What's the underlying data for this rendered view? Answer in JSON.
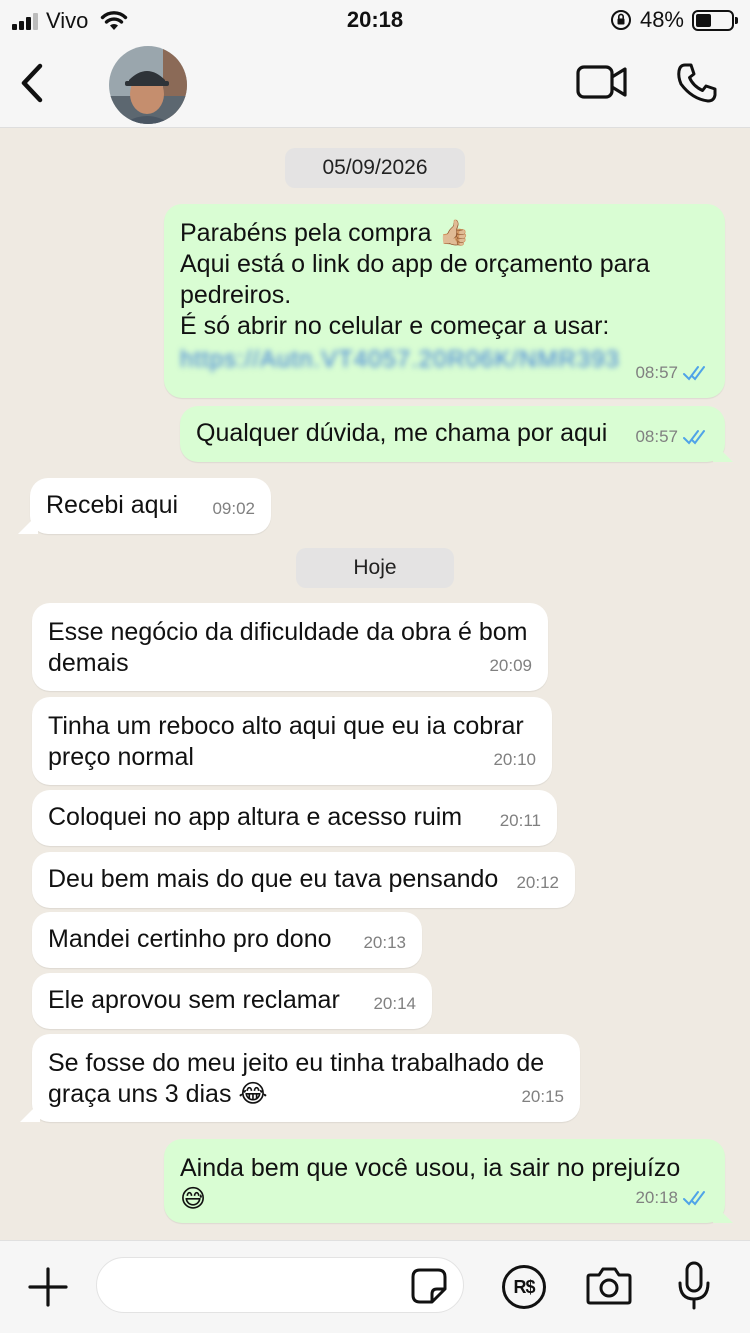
{
  "status_bar": {
    "carrier": "Vivo",
    "time": "20:18",
    "battery": "48%",
    "battery_level": 0.48
  },
  "header": {
    "back_icon": "chevron-left-icon",
    "avatar": "contact-avatar",
    "video_icon": "video-camera-icon",
    "call_icon": "phone-icon"
  },
  "chat": {
    "date_1": "05/09/2026",
    "date_2": "Hoje",
    "messages": [
      {
        "dir": "out",
        "lines": [
          "Parabéns pela compra 👍🏼",
          "Aqui está o link do app de orçamento para",
          "pedreiros.",
          "É só abrir no celular e começar a usar:"
        ],
        "link": "https://Autn.VT4057.20R06K/NMR393",
        "time": "08:57"
      },
      {
        "dir": "out",
        "text": "Qualquer dúvida, me chama por aqui",
        "time": "08:57"
      },
      {
        "dir": "in",
        "text": "Recebi aqui",
        "time": "09:02"
      },
      {
        "dir": "in",
        "lines": [
          "Esse negócio da dificuldade da obra é bom",
          "demais"
        ],
        "time": "20:09"
      },
      {
        "dir": "in",
        "lines": [
          "Tinha um reboco alto aqui que eu ia cobrar",
          "preço normal"
        ],
        "time": "20:10"
      },
      {
        "dir": "in",
        "text": "Coloquei no app altura e acesso ruim",
        "time": "20:11"
      },
      {
        "dir": "in",
        "text": "Deu bem mais do que eu tava pensando",
        "time": "20:12"
      },
      {
        "dir": "in",
        "text": "Mandei certinho pro dono",
        "time": "20:13"
      },
      {
        "dir": "in",
        "text": "Ele aprovou sem reclamar",
        "time": "20:14"
      },
      {
        "dir": "in",
        "lines": [
          "Se fosse do meu jeito eu tinha trabalhado de",
          "graça uns 3 dias 😂"
        ],
        "time": "20:15"
      },
      {
        "dir": "out",
        "text": "Ainda bem que você usou, ia sair no prejuízo 😅",
        "time": "20:18"
      }
    ]
  },
  "input_bar": {
    "placeholder": "",
    "plus_icon": "plus-icon",
    "sticker_icon": "sticker-icon",
    "pay_icon": "payment-icon",
    "pay_label": "R$",
    "camera_icon": "camera-icon",
    "mic_icon": "microphone-icon"
  },
  "colors": {
    "outgoing_bubble": "#d9fdd3",
    "incoming_bubble": "#ffffff",
    "chat_background": "#efeae2",
    "read_ticks": "#4fa3e8"
  }
}
